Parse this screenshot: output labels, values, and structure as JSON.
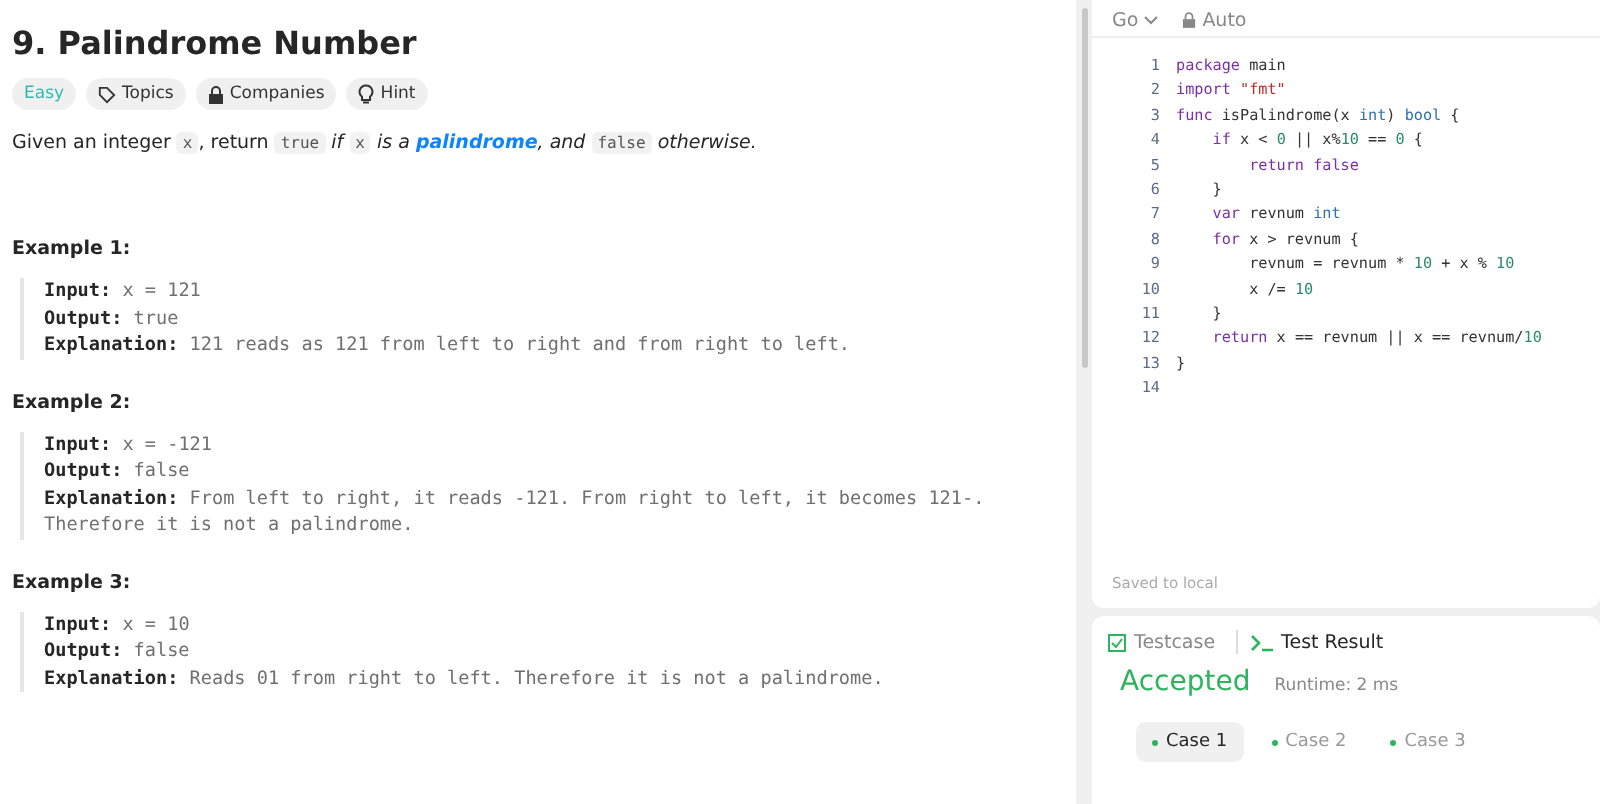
{
  "problem": {
    "title": "9. Palindrome Number",
    "tags": [
      {
        "label": "Easy",
        "kind": "difficulty"
      },
      {
        "label": "Topics",
        "kind": "topics"
      },
      {
        "label": "Companies",
        "kind": "companies"
      },
      {
        "label": "Hint",
        "kind": "hint"
      }
    ],
    "description": [
      {
        "text": "Given an integer ",
        "kind": "plain"
      },
      {
        "text": "x",
        "kind": "code"
      },
      {
        "text": ", return ",
        "kind": "plain"
      },
      {
        "text": "true",
        "kind": "code"
      },
      {
        "text": " if ",
        "kind": "italic"
      },
      {
        "text": "x",
        "kind": "code"
      },
      {
        "text": " is a ",
        "kind": "italic"
      },
      {
        "text": "palindrome",
        "kind": "link"
      },
      {
        "text": ", and ",
        "kind": "italic"
      },
      {
        "text": "false",
        "kind": "code"
      },
      {
        "text": " otherwise.",
        "kind": "italic"
      }
    ],
    "examples": [
      {
        "heading": "Example 1:",
        "lines": [
          {
            "label": "Input:",
            "value": "x = 121"
          },
          {
            "label": "Output:",
            "value": "true"
          },
          {
            "label": "Explanation:",
            "value": "121 reads as 121 from left to right and from right to left."
          }
        ]
      },
      {
        "heading": "Example 2:",
        "lines": [
          {
            "label": "Input:",
            "value": "x = -121"
          },
          {
            "label": "Output:",
            "value": "false"
          },
          {
            "label": "Explanation:",
            "value": "From left to right, it reads -121. From right to left, it becomes 121-. Therefore it is not a palindrome."
          }
        ]
      },
      {
        "heading": "Example 3:",
        "lines": [
          {
            "label": "Input:",
            "value": "x = 10"
          },
          {
            "label": "Output:",
            "value": "false"
          },
          {
            "label": "Explanation:",
            "value": "Reads 01 from right to left. Therefore it is not a palindrome."
          }
        ]
      }
    ]
  },
  "editor": {
    "language": "Go",
    "mode": "Auto",
    "lines": [
      {
        "number": "1",
        "tokens": [
          {
            "text": "package ",
            "kind": "kw"
          },
          {
            "text": "main",
            "kind": "plain"
          }
        ]
      },
      {
        "number": "2",
        "tokens": [
          {
            "text": "import ",
            "kind": "kw"
          },
          {
            "text": "\"fmt\"",
            "kind": "str"
          }
        ]
      },
      {
        "number": "3",
        "tokens": [
          {
            "text": "func ",
            "kind": "kw"
          },
          {
            "text": "isPalindrome(x ",
            "kind": "plain"
          },
          {
            "text": "int",
            "kind": "type"
          },
          {
            "text": ") ",
            "kind": "plain"
          },
          {
            "text": "bool",
            "kind": "type"
          },
          {
            "text": " {",
            "kind": "plain"
          }
        ]
      },
      {
        "number": "4",
        "tokens": [
          {
            "text": "    if ",
            "kind": "kw"
          },
          {
            "text": "x < ",
            "kind": "plain"
          },
          {
            "text": "0",
            "kind": "num"
          },
          {
            "text": " || x%",
            "kind": "plain"
          },
          {
            "text": "10",
            "kind": "num"
          },
          {
            "text": " == ",
            "kind": "plain"
          },
          {
            "text": "0",
            "kind": "num"
          },
          {
            "text": " {",
            "kind": "plain"
          }
        ]
      },
      {
        "number": "5",
        "tokens": [
          {
            "text": "        return false",
            "kind": "kw"
          }
        ]
      },
      {
        "number": "6",
        "tokens": [
          {
            "text": "    }",
            "kind": "plain"
          }
        ]
      },
      {
        "number": "7",
        "tokens": [
          {
            "text": "    var ",
            "kind": "kw"
          },
          {
            "text": "revnum ",
            "kind": "plain"
          },
          {
            "text": "int",
            "kind": "type"
          }
        ]
      },
      {
        "number": "8",
        "tokens": [
          {
            "text": "    for ",
            "kind": "kw"
          },
          {
            "text": "x > revnum {",
            "kind": "plain"
          }
        ]
      },
      {
        "number": "9",
        "tokens": [
          {
            "text": "        revnum = revnum * ",
            "kind": "plain"
          },
          {
            "text": "10",
            "kind": "num"
          },
          {
            "text": " + x % ",
            "kind": "plain"
          },
          {
            "text": "10",
            "kind": "num"
          }
        ]
      },
      {
        "number": "10",
        "tokens": [
          {
            "text": "        x /= ",
            "kind": "plain"
          },
          {
            "text": "10",
            "kind": "num"
          }
        ]
      },
      {
        "number": "11",
        "tokens": [
          {
            "text": "    }",
            "kind": "plain"
          }
        ]
      },
      {
        "number": "12",
        "tokens": [
          {
            "text": "    return ",
            "kind": "kw"
          },
          {
            "text": "x == revnum || x == revnum/",
            "kind": "plain"
          },
          {
            "text": "10",
            "kind": "num"
          }
        ]
      },
      {
        "number": "13",
        "tokens": [
          {
            "text": "}",
            "kind": "plain"
          }
        ]
      },
      {
        "number": "14"
      }
    ],
    "status": "Saved to local"
  },
  "results": {
    "tabs": [
      {
        "label": "Testcase",
        "kind": "testcase",
        "selected": false
      },
      {
        "label": "Test Result",
        "kind": "result",
        "selected": true
      }
    ],
    "verdict": "Accepted",
    "runtime": "Runtime: 2 ms",
    "cases": [
      {
        "label": "Case 1",
        "selected": true
      },
      {
        "label": "Case 2",
        "selected": false
      },
      {
        "label": "Case 3",
        "selected": false
      }
    ]
  }
}
